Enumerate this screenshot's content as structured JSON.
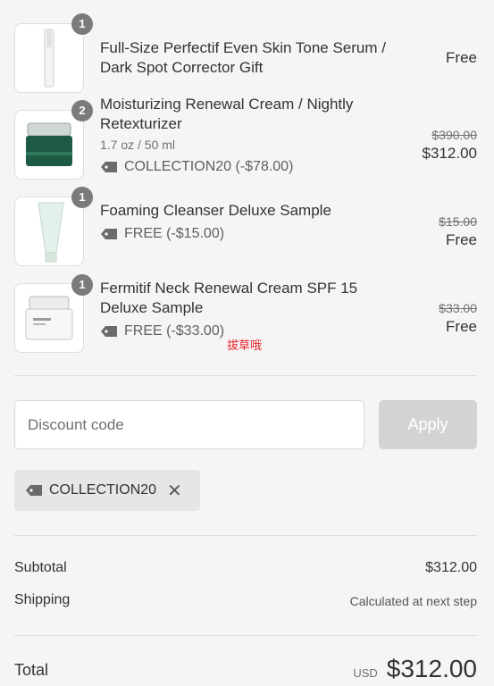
{
  "items": [
    {
      "qty": "1",
      "name": "Full-Size Perfectif Even Skin Tone Serum / Dark Spot Corrector Gift",
      "price": "Free"
    },
    {
      "qty": "2",
      "name": "Moisturizing Renewal Cream / Nightly Retexturizer",
      "variant": "1.7 oz / 50 ml",
      "discount": "COLLECTION20 (-$78.00)",
      "original_price": "$390.00",
      "price": "$312.00"
    },
    {
      "qty": "1",
      "name": "Foaming Cleanser Deluxe Sample",
      "discount": "FREE (-$15.00)",
      "original_price": "$15.00",
      "price": "Free"
    },
    {
      "qty": "1",
      "name": "Fermitif Neck Renewal Cream SPF 15 Deluxe Sample",
      "discount": "FREE (-$33.00)",
      "original_price": "$33.00",
      "price": "Free"
    }
  ],
  "discount_code": {
    "placeholder": "Discount code",
    "apply_label": "Apply"
  },
  "applied_code": {
    "code": "COLLECTION20",
    "remove_icon": "close-icon"
  },
  "summary": {
    "subtotal_label": "Subtotal",
    "subtotal_value": "$312.00",
    "shipping_label": "Shipping",
    "shipping_value": "Calculated at next step",
    "total_label": "Total",
    "currency": "USD",
    "total_value": "$312.00"
  },
  "watermark": "拔草哦",
  "colors": {
    "apply_bg": "#d3d3d3",
    "qty_badge": "#7b7b7b",
    "chip_bg": "#e6e6e6"
  }
}
